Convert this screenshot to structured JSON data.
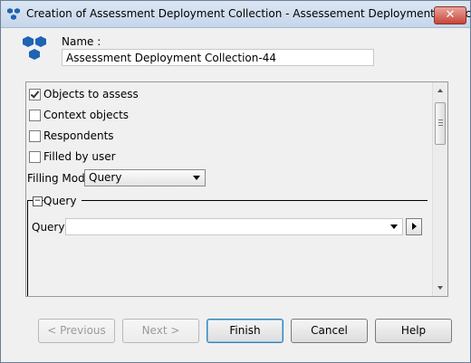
{
  "window": {
    "title": "Creation of Assessment Deployment Collection - Assessement Deployment Collect...",
    "close_glyph": "✕"
  },
  "name": {
    "label": "Name :",
    "value": "Assessment Deployment Collection-44"
  },
  "options": {
    "objects_to_assess": {
      "label": "Objects to assess",
      "checked": true
    },
    "context_objects": {
      "label": "Context objects",
      "checked": false
    },
    "respondents": {
      "label": "Respondents",
      "checked": false
    },
    "filled_by_user": {
      "label": "Filled by user",
      "checked": false
    }
  },
  "filling_mode": {
    "label": "Filling Mode:",
    "value": "Query"
  },
  "query_group": {
    "title": "Query",
    "toggle_glyph": "−",
    "query_label": "Query:",
    "query_value": ""
  },
  "buttons": {
    "previous": "< Previous",
    "next": "Next >",
    "finish": "Finish",
    "cancel": "Cancel",
    "help": "Help"
  },
  "colors": {
    "accent": "#3c7fb1",
    "logo": "#1f63b3"
  }
}
